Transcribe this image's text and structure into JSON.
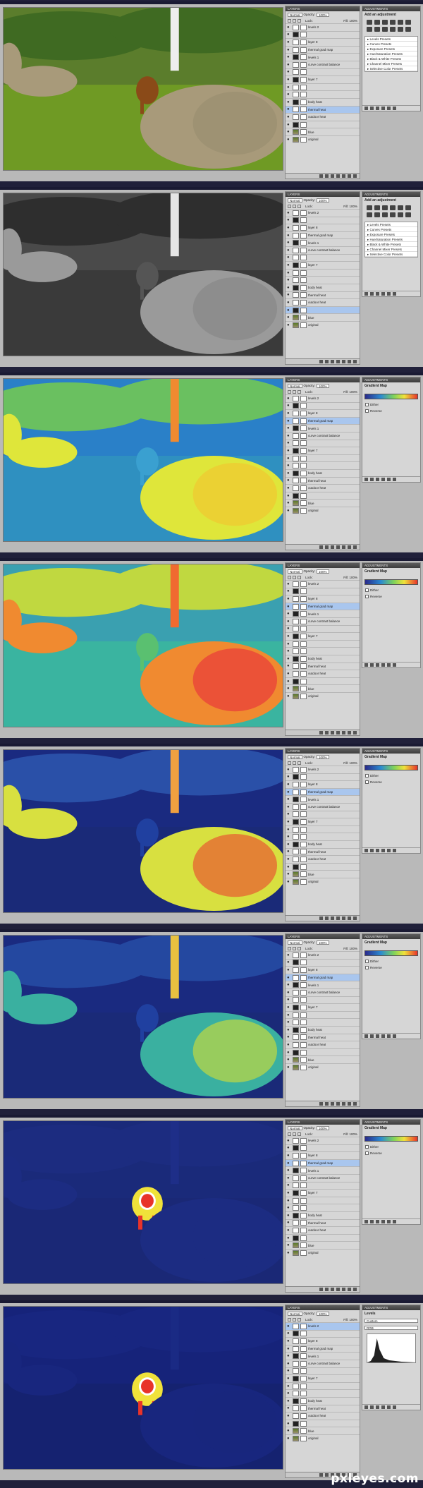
{
  "watermark": "pxleyes.com",
  "layers_panel": {
    "tab_label": "LAYERS",
    "blend_mode": "Normal",
    "opacity_label": "Opacity:",
    "opacity_value": "100%",
    "lock_label": "Lock:",
    "fill_label": "Fill:",
    "fill_value": "100%"
  },
  "adjustments_panel": {
    "tab_label": "ADJUSTMENTS",
    "add_title": "Add an adjustment",
    "gradient_title": "Gradient Map",
    "dither_label": "Dither",
    "reverse_label": "Reverse",
    "levels_title": "Levels",
    "levels_preset": "Custom",
    "levels_channel": "RGB",
    "presets": [
      "Levels Presets",
      "Curves Presets",
      "Exposure Presets",
      "Hue/Saturation Presets",
      "Black & White Presets",
      "Channel Mixer Presets",
      "Selective Color Presets"
    ]
  },
  "steps": [
    {
      "image": "color",
      "active_layer": 11,
      "panel": "add",
      "layers": [
        "levels 2",
        "",
        "layer 8",
        "thermal grad map",
        "levels 1",
        "curve contrast balance",
        "",
        "layer 7",
        "",
        "",
        "body heat",
        "thermal heat",
        "outdoor heat",
        "",
        "blue",
        "original"
      ]
    },
    {
      "image": "gray",
      "active_layer": 13,
      "panel": "add",
      "layers": [
        "levels 2",
        "",
        "layer 8",
        "thermal grad map",
        "levels 1",
        "curve contrast balance",
        "",
        "layer 7",
        "",
        "",
        "body heat",
        "thermal heat",
        "outdoor heat",
        "",
        "blue",
        "original"
      ]
    },
    {
      "image": "thermal1",
      "active_layer": 3,
      "panel": "gradient",
      "layers": [
        "levels 2",
        "",
        "layer 8",
        "thermal grad map",
        "levels 1",
        "curve contrast balance",
        "",
        "layer 7",
        "",
        "",
        "body heat",
        "thermal heat",
        "outdoor heat",
        "",
        "blue",
        "original"
      ]
    },
    {
      "image": "thermal2",
      "active_layer": 3,
      "panel": "gradient",
      "layers": [
        "levels 2",
        "",
        "layer 8",
        "thermal grad map",
        "levels 1",
        "curve contrast balance",
        "",
        "layer 7",
        "",
        "",
        "body heat",
        "thermal heat",
        "outdoor heat",
        "",
        "blue",
        "original"
      ]
    },
    {
      "image": "thermal3",
      "active_layer": 3,
      "panel": "gradient",
      "layers": [
        "levels 2",
        "",
        "layer 8",
        "thermal grad map",
        "levels 1",
        "curve contrast balance",
        "",
        "layer 7",
        "",
        "",
        "body heat",
        "thermal heat",
        "outdoor heat",
        "",
        "blue",
        "original"
      ]
    },
    {
      "image": "thermal4",
      "active_layer": 3,
      "panel": "gradient",
      "layers": [
        "levels 2",
        "",
        "layer 8",
        "thermal grad map",
        "levels 1",
        "curve contrast balance",
        "",
        "layer 7",
        "",
        "",
        "body heat",
        "thermal heat",
        "outdoor heat",
        "",
        "blue",
        "original"
      ]
    },
    {
      "image": "dogonly",
      "active_layer": 3,
      "panel": "gradient",
      "layers": [
        "levels 2",
        "",
        "layer 8",
        "thermal grad map",
        "levels 1",
        "curve contrast balance",
        "",
        "layer 7",
        "",
        "",
        "body heat",
        "thermal heat",
        "outdoor heat",
        "",
        "blue",
        "original"
      ]
    },
    {
      "image": "dogonly2",
      "active_layer": 0,
      "panel": "levels",
      "layers": [
        "levels 2",
        "",
        "layer 8",
        "thermal grad map",
        "levels 1",
        "curve contrast balance",
        "",
        "layer 7",
        "",
        "",
        "body heat",
        "thermal heat",
        "outdoor heat",
        "",
        "blue",
        "original"
      ]
    }
  ],
  "colors": {
    "accent": "#a9c6ee",
    "panel_bg": "#d6d6d6",
    "separator": "#1a1a33"
  }
}
